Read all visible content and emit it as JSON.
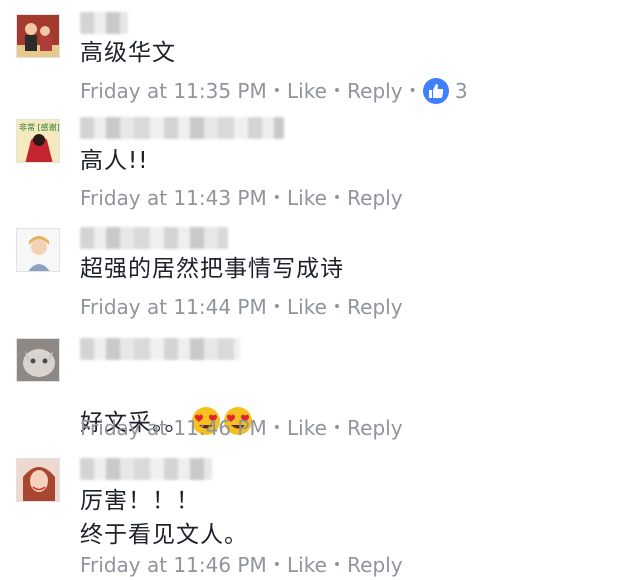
{
  "comments": [
    {
      "text": "高级华文",
      "time": "Friday at 11:35 PM",
      "like": "Like",
      "reply": "Reply",
      "reactions": "3"
    },
    {
      "text": "高人!!",
      "time": "Friday at 11:43 PM",
      "like": "Like",
      "reply": "Reply"
    },
    {
      "text": "超强的居然把事情写成诗",
      "time": "Friday at 11:44 PM",
      "like": "Like",
      "reply": "Reply"
    },
    {
      "text": "好文采。。",
      "emoji": [
        "heart-eyes-emoji",
        "heart-eyes-emoji"
      ],
      "time": "Friday at 11:46 PM",
      "like": "Like",
      "reply": "Reply"
    },
    {
      "text": "厉害！！！\n终于看见文人。",
      "time": "Friday at 11:46 PM",
      "like": "Like",
      "reply": "Reply"
    }
  ],
  "avatar_2_caption": "非常 [感谢]",
  "colors": {
    "meta_text": "#90949c",
    "like_badge": "#4080ff",
    "body_text": "#1d2129"
  }
}
